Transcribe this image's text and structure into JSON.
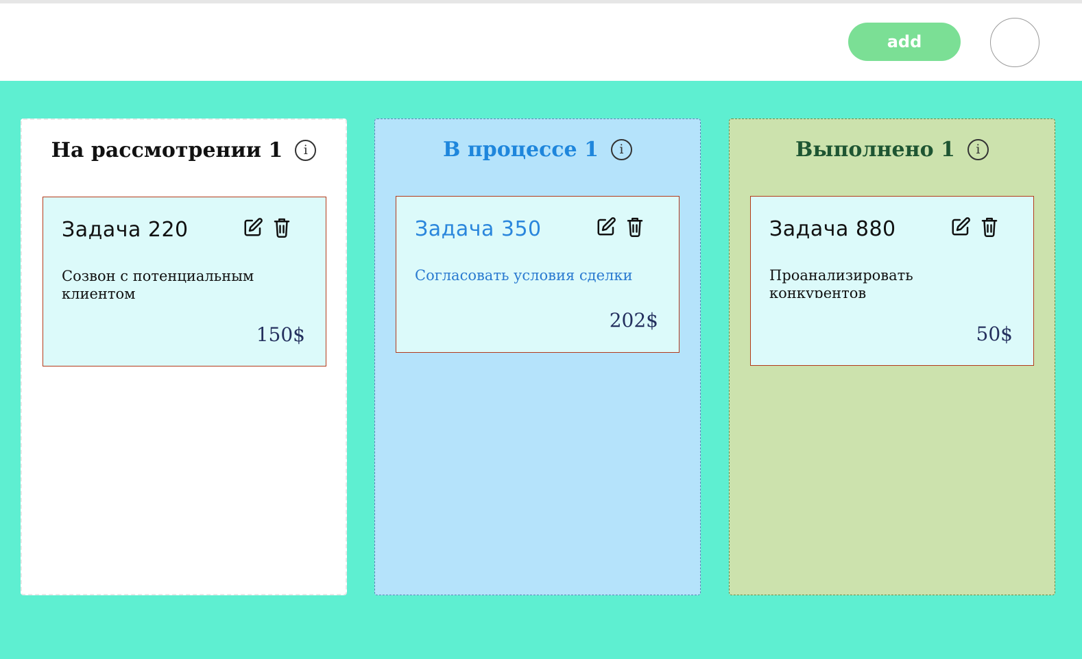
{
  "header": {
    "add_label": "add"
  },
  "columns": [
    {
      "title": "На рассмотрении 1",
      "info": "i",
      "color": "#ffffff",
      "card": {
        "title": "Задача 220",
        "description": "Созвон с потенциальным клиентом",
        "price": "150$"
      }
    },
    {
      "title": "В процессе 1",
      "info": "i",
      "color": "#b5e3fb",
      "card": {
        "title": "Задача 350",
        "description": "Согласовать условия сделки",
        "price": "202$"
      }
    },
    {
      "title": "Выполнено 1",
      "info": "i",
      "color": "#cce2ad",
      "card": {
        "title": "Задача 880",
        "description": "Проанализировать конкурентов",
        "price": "50$"
      }
    }
  ],
  "icons": {
    "edit": "edit-icon",
    "delete": "trash-icon",
    "info": "info-icon"
  },
  "colors": {
    "background": "#5eefd1",
    "add_button": "#7bdf95",
    "card_background": "#dcfafa",
    "card_border": "#b33a1a"
  }
}
